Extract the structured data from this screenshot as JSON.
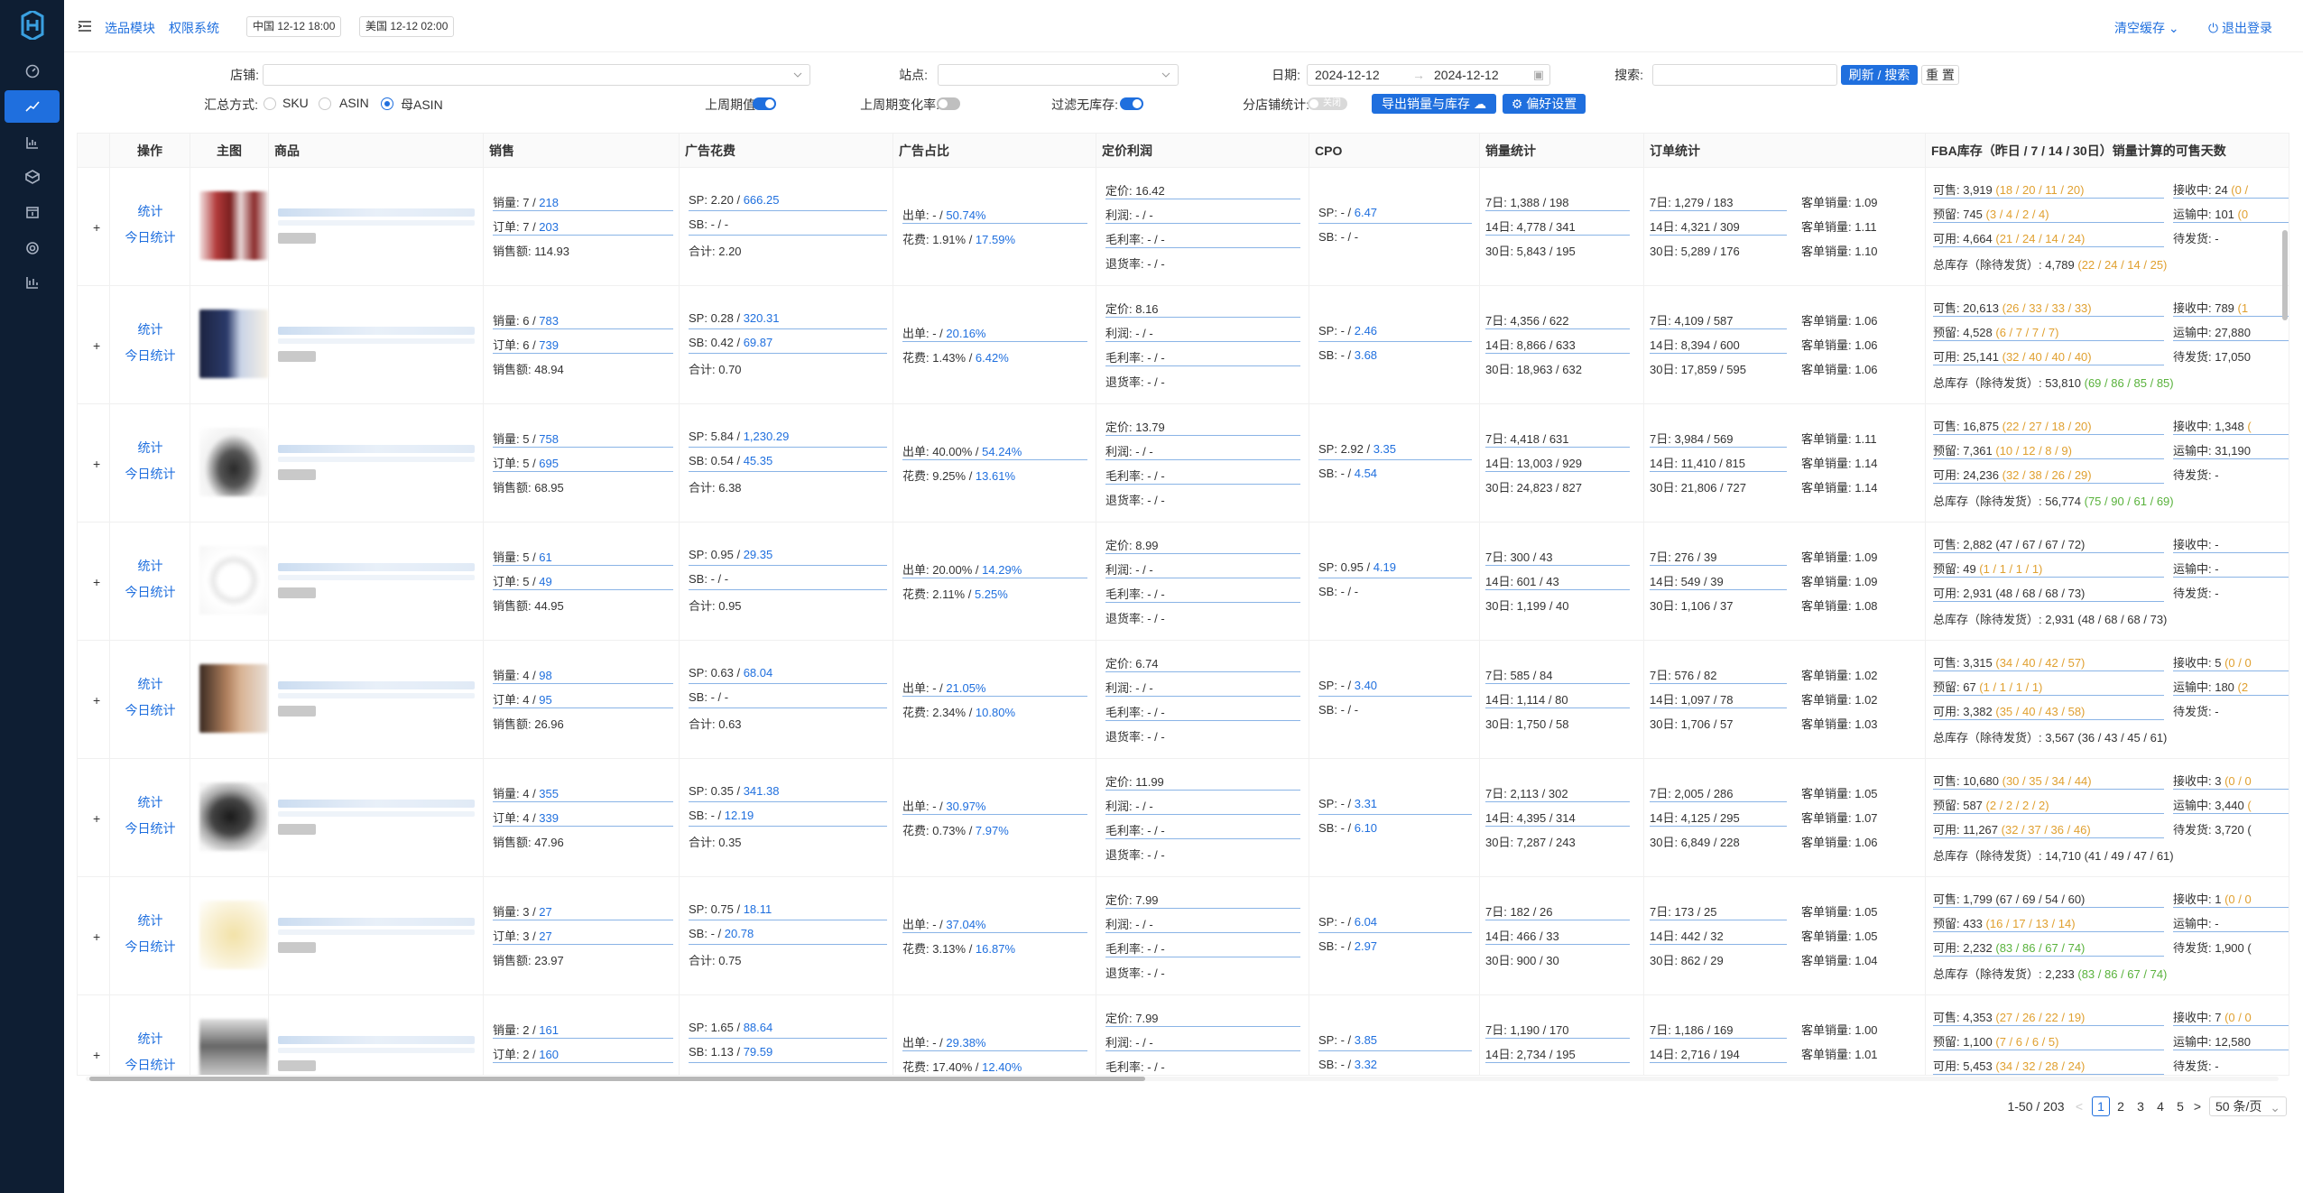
{
  "topbar": {
    "module_link": "选品模块",
    "perm_link": "权限系统",
    "tz_cn": "中国 12-12 18:00",
    "tz_us": "美国 12-12 02:00",
    "clear_cache": "清空缓存",
    "logout": "退出登录"
  },
  "filters": {
    "shop_label": "店铺:",
    "site_label": "站点:",
    "date_label": "日期:",
    "date_start": "2024-12-12",
    "date_sep": "→",
    "date_end": "2024-12-12",
    "search_label": "搜索:",
    "search_button": "刷新 / 搜索",
    "reset_button": "重 置",
    "summary_label": "汇总方式:",
    "summary_options": [
      "SKU",
      "ASIN",
      "母ASIN"
    ],
    "prev_period_label": "上周期值:",
    "prev_change_label": "上周期变化率:",
    "filter_stock_label": "过滤无库存:",
    "split_shop_label": "分店铺统计:",
    "split_shop_switch": "关闭",
    "export_button": "导出销量与库存",
    "pref_button": "偏好设置"
  },
  "table": {
    "headers": [
      "操作",
      "主图",
      "商品",
      "销售",
      "广告花费",
      "广告占比",
      "定价利润",
      "CPO",
      "销量统计",
      "订单统计",
      "FBA库存（昨日 / 7 / 14 / 30日）销量计算的可售天数"
    ],
    "op_stats": "统计",
    "op_today": "今日统计",
    "expand": "+",
    "rows": [
      {
        "sales_qty": "销量: 7 / ",
        "sales_qty_b": "218",
        "orders": "订单: 7 / ",
        "orders_b": "203",
        "amount": "销售额: 114.93",
        "sp": "SP: 2.20 / ",
        "sp_b": "666.25",
        "sb": "SB: - / -",
        "sb_b": "",
        "total": "合计: 2.20",
        "ad_order": "出单: - / ",
        "ad_order_b": "50.74%",
        "ad_spend": "花费: 1.91% / ",
        "ad_spend_b": "17.59%",
        "price": "定价: 16.42",
        "profit": "利润: - / -",
        "margin": "毛利率: - / -",
        "refund": "退货率: - / -",
        "cpo_sp": "SP: - / ",
        "cpo_sp_b": "6.47",
        "cpo_sb": "SB: - / -",
        "cpo_sb_b": "",
        "s7": "7日: 1,388 / 198",
        "s14": "14日: 4,778 / 341",
        "s30": "30日: 5,843 / 195",
        "o7": "7日: 1,279 / 183",
        "o14": "14日: 4,321 / 309",
        "o30": "30日: 5,289 / 176",
        "k1": "客单销量: 1.09",
        "k2": "客单销量: 1.11",
        "k3": "客单销量: 1.10",
        "inv_sell": "可售: 3,919 ",
        "inv_sell_c": "(18 / 20 / 11 / 20)",
        "inv_sell_k": "o",
        "inv_res": "预留: 745 ",
        "inv_res_c": "(3 / 4 / 2 / 4)",
        "inv_res_k": "o",
        "inv_avail": "可用: 4,664 ",
        "inv_avail_c": "(21 / 24 / 14 / 24)",
        "inv_avail_k": "o",
        "inv_total": "总库存（除待发货）: 4,789 ",
        "inv_total_c": "(22 / 24 / 14 / 25)",
        "inv_total_k": "o",
        "recv": "接收中: 24 ",
        "recv_c": "(0 /",
        "recv_k": "o",
        "transit": "运输中: 101 ",
        "transit_c": "(0",
        "transit_k": "o",
        "pending": "待发货: -"
      },
      {
        "sales_qty": "销量: 6 / ",
        "sales_qty_b": "783",
        "orders": "订单: 6 / ",
        "orders_b": "739",
        "amount": "销售额: 48.94",
        "sp": "SP: 0.28 / ",
        "sp_b": "320.31",
        "sb": "SB: 0.42 / ",
        "sb_b": "69.87",
        "total": "合计: 0.70",
        "ad_order": "出单: - / ",
        "ad_order_b": "20.16%",
        "ad_spend": "花费: 1.43% / ",
        "ad_spend_b": "6.42%",
        "price": "定价: 8.16",
        "profit": "利润: - / -",
        "margin": "毛利率: - / -",
        "refund": "退货率: - / -",
        "cpo_sp": "SP: - / ",
        "cpo_sp_b": "2.46",
        "cpo_sb": "SB: - / ",
        "cpo_sb_b": "3.68",
        "s7": "7日: 4,356 / 622",
        "s14": "14日: 8,866 / 633",
        "s30": "30日: 18,963 / 632",
        "o7": "7日: 4,109 / 587",
        "o14": "14日: 8,394 / 600",
        "o30": "30日: 17,859 / 595",
        "k1": "客单销量: 1.06",
        "k2": "客单销量: 1.06",
        "k3": "客单销量: 1.06",
        "inv_sell": "可售: 20,613 ",
        "inv_sell_c": "(26 / 33 / 33 / 33)",
        "inv_sell_k": "o",
        "inv_res": "预留: 4,528 ",
        "inv_res_c": "(6 / 7 / 7 / 7)",
        "inv_res_k": "o",
        "inv_avail": "可用: 25,141 ",
        "inv_avail_c": "(32 / 40 / 40 / 40)",
        "inv_avail_k": "o",
        "inv_total": "总库存（除待发货）: 53,810 ",
        "inv_total_c": "(69 / 86 / 85 / 85)",
        "inv_total_k": "g",
        "recv": "接收中: 789 ",
        "recv_c": "(1",
        "recv_k": "o",
        "transit": "运输中: 27,880",
        "transit_c": "",
        "transit_k": "o",
        "pending": "待发货: 17,050"
      },
      {
        "sales_qty": "销量: 5 / ",
        "sales_qty_b": "758",
        "orders": "订单: 5 / ",
        "orders_b": "695",
        "amount": "销售额: 68.95",
        "sp": "SP: 5.84 / ",
        "sp_b": "1,230.29",
        "sb": "SB: 0.54 / ",
        "sb_b": "45.35",
        "total": "合计: 6.38",
        "ad_order": "出单: 40.00% / ",
        "ad_order_b": "54.24%",
        "ad_spend": "花费: 9.25% / ",
        "ad_spend_b": "13.61%",
        "price": "定价: 13.79",
        "profit": "利润: - / -",
        "margin": "毛利率: - / -",
        "refund": "退货率: - / -",
        "cpo_sp": "SP: 2.92 / ",
        "cpo_sp_b": "3.35",
        "cpo_sb": "SB: - / ",
        "cpo_sb_b": "4.54",
        "s7": "7日: 4,418 / 631",
        "s14": "14日: 13,003 / 929",
        "s30": "30日: 24,823 / 827",
        "o7": "7日: 3,984 / 569",
        "o14": "14日: 11,410 / 815",
        "o30": "30日: 21,806 / 727",
        "k1": "客单销量: 1.11",
        "k2": "客单销量: 1.14",
        "k3": "客单销量: 1.14",
        "inv_sell": "可售: 16,875 ",
        "inv_sell_c": "(22 / 27 / 18 / 20)",
        "inv_sell_k": "o",
        "inv_res": "预留: 7,361 ",
        "inv_res_c": "(10 / 12 / 8 / 9)",
        "inv_res_k": "o",
        "inv_avail": "可用: 24,236 ",
        "inv_avail_c": "(32 / 38 / 26 / 29)",
        "inv_avail_k": "o",
        "inv_total": "总库存（除待发货）: 56,774 ",
        "inv_total_c": "(75 / 90 / 61 / 69)",
        "inv_total_k": "g",
        "recv": "接收中: 1,348 ",
        "recv_c": "(",
        "recv_k": "o",
        "transit": "运输中: 31,190",
        "transit_c": "",
        "transit_k": "o",
        "pending": "待发货: -"
      },
      {
        "sales_qty": "销量: 5 / ",
        "sales_qty_b": "61",
        "orders": "订单: 5 / ",
        "orders_b": "49",
        "amount": "销售额: 44.95",
        "sp": "SP: 0.95 / ",
        "sp_b": "29.35",
        "sb": "SB: - / -",
        "sb_b": "",
        "total": "合计: 0.95",
        "ad_order": "出单: 20.00% / ",
        "ad_order_b": "14.29%",
        "ad_spend": "花费: 2.11% / ",
        "ad_spend_b": "5.25%",
        "price": "定价: 8.99",
        "profit": "利润: - / -",
        "margin": "毛利率: - / -",
        "refund": "退货率: - / -",
        "cpo_sp": "SP: 0.95 / ",
        "cpo_sp_b": "4.19",
        "cpo_sb": "SB: - / -",
        "cpo_sb_b": "",
        "s7": "7日: 300 / 43",
        "s14": "14日: 601 / 43",
        "s30": "30日: 1,199 / 40",
        "o7": "7日: 276 / 39",
        "o14": "14日: 549 / 39",
        "o30": "30日: 1,106 / 37",
        "k1": "客单销量: 1.09",
        "k2": "客单销量: 1.09",
        "k3": "客单销量: 1.08",
        "inv_sell": "可售: 2,882 ",
        "inv_sell_c": "(47 / 67 / 67 / 72)",
        "inv_sell_k": "n",
        "inv_res": "预留: 49 ",
        "inv_res_c": "(1 / 1 / 1 / 1)",
        "inv_res_k": "o",
        "inv_avail": "可用: 2,931 ",
        "inv_avail_c": "(48 / 68 / 68 / 73)",
        "inv_avail_k": "n",
        "inv_total": "总库存（除待发货）: 2,931 ",
        "inv_total_c": "(48 / 68 / 68 / 73)",
        "inv_total_k": "n",
        "recv": "接收中: -",
        "recv_c": "",
        "recv_k": "n",
        "transit": "运输中: -",
        "transit_c": "",
        "transit_k": "n",
        "pending": "待发货: -"
      },
      {
        "sales_qty": "销量: 4 / ",
        "sales_qty_b": "98",
        "orders": "订单: 4 / ",
        "orders_b": "95",
        "amount": "销售额: 26.96",
        "sp": "SP: 0.63 / ",
        "sp_b": "68.04",
        "sb": "SB: - / -",
        "sb_b": "",
        "total": "合计: 0.63",
        "ad_order": "出单: - / ",
        "ad_order_b": "21.05%",
        "ad_spend": "花费: 2.34% / ",
        "ad_spend_b": "10.80%",
        "price": "定价: 6.74",
        "profit": "利润: - / -",
        "margin": "毛利率: - / -",
        "refund": "退货率: - / -",
        "cpo_sp": "SP: - / ",
        "cpo_sp_b": "3.40",
        "cpo_sb": "SB: - / -",
        "cpo_sb_b": "",
        "s7": "7日: 585 / 84",
        "s14": "14日: 1,114 / 80",
        "s30": "30日: 1,750 / 58",
        "o7": "7日: 576 / 82",
        "o14": "14日: 1,097 / 78",
        "o30": "30日: 1,706 / 57",
        "k1": "客单销量: 1.02",
        "k2": "客单销量: 1.02",
        "k3": "客单销量: 1.03",
        "inv_sell": "可售: 3,315 ",
        "inv_sell_c": "(34 / 40 / 42 / 57)",
        "inv_sell_k": "o",
        "inv_res": "预留: 67 ",
        "inv_res_c": "(1 / 1 / 1 / 1)",
        "inv_res_k": "o",
        "inv_avail": "可用: 3,382 ",
        "inv_avail_c": "(35 / 40 / 43 / 58)",
        "inv_avail_k": "o",
        "inv_total": "总库存（除待发货）: 3,567 ",
        "inv_total_c": "(36 / 43 / 45 / 61)",
        "inv_total_k": "n",
        "recv": "接收中: 5 ",
        "recv_c": "(0 / 0",
        "recv_k": "o",
        "transit": "运输中: 180 ",
        "transit_c": "(2",
        "transit_k": "o",
        "pending": "待发货: -"
      },
      {
        "sales_qty": "销量: 4 / ",
        "sales_qty_b": "355",
        "orders": "订单: 4 / ",
        "orders_b": "339",
        "amount": "销售额: 47.96",
        "sp": "SP: 0.35 / ",
        "sp_b": "341.38",
        "sb": "SB: - / ",
        "sb_b": "12.19",
        "total": "合计: 0.35",
        "ad_order": "出单: - / ",
        "ad_order_b": "30.97%",
        "ad_spend": "花费: 0.73% / ",
        "ad_spend_b": "7.97%",
        "price": "定价: 11.99",
        "profit": "利润: - / -",
        "margin": "毛利率: - / -",
        "refund": "退货率: - / -",
        "cpo_sp": "SP: - / ",
        "cpo_sp_b": "3.31",
        "cpo_sb": "SB: - / ",
        "cpo_sb_b": "6.10",
        "s7": "7日: 2,113 / 302",
        "s14": "14日: 4,395 / 314",
        "s30": "30日: 7,287 / 243",
        "o7": "7日: 2,005 / 286",
        "o14": "14日: 4,125 / 295",
        "o30": "30日: 6,849 / 228",
        "k1": "客单销量: 1.05",
        "k2": "客单销量: 1.07",
        "k3": "客单销量: 1.06",
        "inv_sell": "可售: 10,680 ",
        "inv_sell_c": "(30 / 35 / 34 / 44)",
        "inv_sell_k": "o",
        "inv_res": "预留: 587 ",
        "inv_res_c": "(2 / 2 / 2 / 2)",
        "inv_res_k": "o",
        "inv_avail": "可用: 11,267 ",
        "inv_avail_c": "(32 / 37 / 36 / 46)",
        "inv_avail_k": "o",
        "inv_total": "总库存（除待发货）: 14,710 ",
        "inv_total_c": "(41 / 49 / 47 / 61)",
        "inv_total_k": "n",
        "recv": "接收中: 3 ",
        "recv_c": "(0 / 0",
        "recv_k": "o",
        "transit": "运输中: 3,440 ",
        "transit_c": "(",
        "transit_k": "o",
        "pending": "待发货: 3,720 ("
      },
      {
        "sales_qty": "销量: 3 / ",
        "sales_qty_b": "27",
        "orders": "订单: 3 / ",
        "orders_b": "27",
        "amount": "销售额: 23.97",
        "sp": "SP: 0.75 / ",
        "sp_b": "18.11",
        "sb": "SB: - / ",
        "sb_b": "20.78",
        "total": "合计: 0.75",
        "ad_order": "出单: - / ",
        "ad_order_b": "37.04%",
        "ad_spend": "花费: 3.13% / ",
        "ad_spend_b": "16.87%",
        "price": "定价: 7.99",
        "profit": "利润: - / -",
        "margin": "毛利率: - / -",
        "refund": "退货率: - / -",
        "cpo_sp": "SP: - / ",
        "cpo_sp_b": "6.04",
        "cpo_sb": "SB: - / ",
        "cpo_sb_b": "2.97",
        "s7": "7日: 182 / 26",
        "s14": "14日: 466 / 33",
        "s30": "30日: 900 / 30",
        "o7": "7日: 173 / 25",
        "o14": "14日: 442 / 32",
        "o30": "30日: 862 / 29",
        "k1": "客单销量: 1.05",
        "k2": "客单销量: 1.05",
        "k3": "客单销量: 1.04",
        "inv_sell": "可售: 1,799 ",
        "inv_sell_c": "(67 / 69 / 54 / 60)",
        "inv_sell_k": "n",
        "inv_res": "预留: 433 ",
        "inv_res_c": "(16 / 17 / 13 / 14)",
        "inv_res_k": "o",
        "inv_avail": "可用: 2,232 ",
        "inv_avail_c": "(83 / 86 / 67 / 74)",
        "inv_avail_k": "g",
        "inv_total": "总库存（除待发货）: 2,233 ",
        "inv_total_c": "(83 / 86 / 67 / 74)",
        "inv_total_k": "g",
        "recv": "接收中: 1 ",
        "recv_c": "(0 / 0",
        "recv_k": "o",
        "transit": "运输中: -",
        "transit_c": "",
        "transit_k": "n",
        "pending": "待发货: 1,900 ("
      },
      {
        "sales_qty": "销量: 2 / ",
        "sales_qty_b": "161",
        "orders": "订单: 2 / ",
        "orders_b": "160",
        "amount": "",
        "sp": "SP: 1.65 / ",
        "sp_b": "88.64",
        "sb": "SB: 1.13 / ",
        "sb_b": "79.59",
        "total": "",
        "ad_order": "出单: - / ",
        "ad_order_b": "29.38%",
        "ad_spend": "花费: 17.40% / ",
        "ad_spend_b": "12.40%",
        "price": "定价: 7.99",
        "profit": "利润: - / -",
        "margin": "毛利率: - / -",
        "refund": "",
        "cpo_sp": "SP: - / ",
        "cpo_sp_b": "3.85",
        "cpo_sb": "SB: - / ",
        "cpo_sb_b": "3.32",
        "s7": "7日: 1,190 / 170",
        "s14": "14日: 2,734 / 195",
        "s30": "",
        "o7": "7日: 1,186 / 169",
        "o14": "14日: 2,716 / 194",
        "o30": "",
        "k1": "客单销量: 1.00",
        "k2": "客单销量: 1.01",
        "k3": "",
        "inv_sell": "可售: 4,353 ",
        "inv_sell_c": "(27 / 26 / 22 / 19)",
        "inv_sell_k": "o",
        "inv_res": "预留: 1,100 ",
        "inv_res_c": "(7 / 6 / 6 / 5)",
        "inv_res_k": "o",
        "inv_avail": "可用: 5,453 ",
        "inv_avail_c": "(34 / 32 / 28 / 24)",
        "inv_avail_k": "o",
        "inv_total": "",
        "inv_total_c": "",
        "inv_total_k": "n",
        "recv": "接收中: 7 ",
        "recv_c": "(0 / 0",
        "recv_k": "o",
        "transit": "运输中: 12,580",
        "transit_c": "",
        "transit_k": "o",
        "pending": "待发货: -"
      }
    ]
  },
  "pager": {
    "range": "1-50 / 203",
    "pages": [
      "1",
      "2",
      "3",
      "4",
      "5"
    ],
    "page_size": "50 条/页",
    "prev": "<",
    "next": ">"
  },
  "colors": {
    "primary": "#1f6fde",
    "orange": "#e0a030",
    "green": "#59b23c",
    "sidebar": "#0e1e33"
  }
}
